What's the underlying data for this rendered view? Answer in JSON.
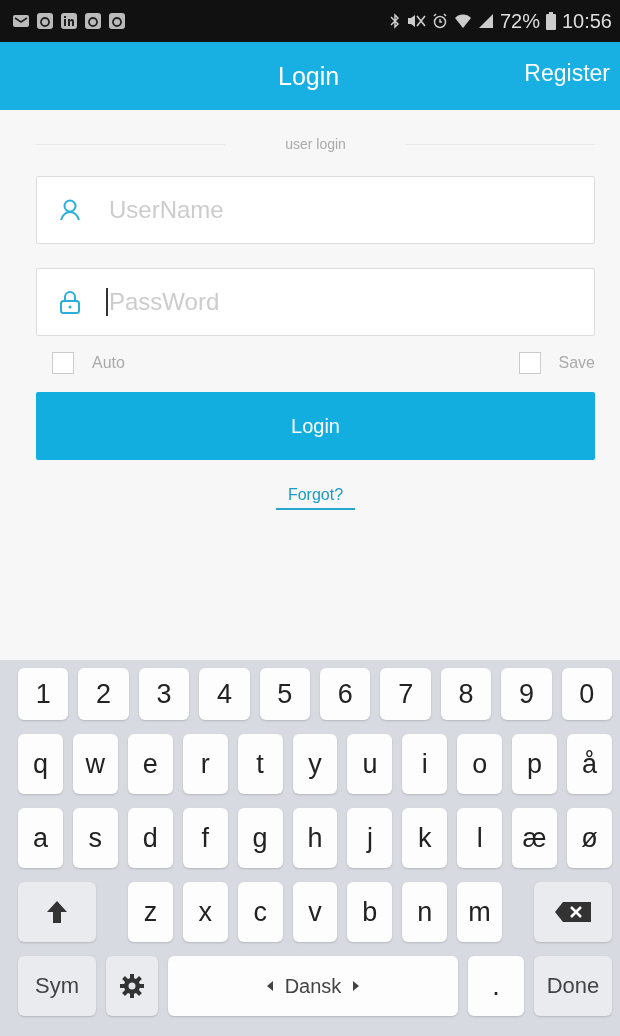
{
  "status_bar": {
    "battery": "72%",
    "time": "10:56"
  },
  "header": {
    "title": "Login",
    "action": "Register"
  },
  "form": {
    "section_label": "user login",
    "fields": [
      {
        "kind": "user",
        "placeholder": "UserName",
        "focused": false
      },
      {
        "kind": "password",
        "placeholder": "PassWord",
        "focused": true
      }
    ],
    "options": [
      {
        "label": "Auto",
        "checked": false
      },
      {
        "label": "Save",
        "checked": false
      }
    ],
    "submit": "Login",
    "forgot_link": "Forgot?"
  },
  "keyboard": {
    "rows": [
      {
        "keys": [
          {
            "kind": "char",
            "label": "1"
          },
          {
            "kind": "char",
            "label": "2"
          },
          {
            "kind": "char",
            "label": "3"
          },
          {
            "kind": "char",
            "label": "4"
          },
          {
            "kind": "char",
            "label": "5"
          },
          {
            "kind": "char",
            "label": "6"
          },
          {
            "kind": "char",
            "label": "7"
          },
          {
            "kind": "char",
            "label": "8"
          },
          {
            "kind": "char",
            "label": "9"
          },
          {
            "kind": "char",
            "label": "0"
          }
        ]
      },
      {
        "keys": [
          {
            "kind": "char",
            "label": "q"
          },
          {
            "kind": "char",
            "label": "w"
          },
          {
            "kind": "char",
            "label": "e"
          },
          {
            "kind": "char",
            "label": "r"
          },
          {
            "kind": "char",
            "label": "t"
          },
          {
            "kind": "char",
            "label": "y"
          },
          {
            "kind": "char",
            "label": "u"
          },
          {
            "kind": "char",
            "label": "i"
          },
          {
            "kind": "char",
            "label": "o"
          },
          {
            "kind": "char",
            "label": "p"
          },
          {
            "kind": "char",
            "label": "å"
          }
        ]
      },
      {
        "keys": [
          {
            "kind": "char",
            "label": "a"
          },
          {
            "kind": "char",
            "label": "s"
          },
          {
            "kind": "char",
            "label": "d"
          },
          {
            "kind": "char",
            "label": "f"
          },
          {
            "kind": "char",
            "label": "g"
          },
          {
            "kind": "char",
            "label": "h"
          },
          {
            "kind": "char",
            "label": "j"
          },
          {
            "kind": "char",
            "label": "k"
          },
          {
            "kind": "char",
            "label": "l"
          },
          {
            "kind": "char",
            "label": "æ"
          },
          {
            "kind": "char",
            "label": "ø"
          }
        ]
      },
      {
        "keys": [
          {
            "kind": "shift"
          },
          {
            "kind": "char",
            "label": "z"
          },
          {
            "kind": "char",
            "label": "x"
          },
          {
            "kind": "char",
            "label": "c"
          },
          {
            "kind": "char",
            "label": "v"
          },
          {
            "kind": "char",
            "label": "b"
          },
          {
            "kind": "char",
            "label": "n"
          },
          {
            "kind": "char",
            "label": "m"
          },
          {
            "kind": "backspace"
          }
        ]
      },
      {
        "keys": [
          {
            "kind": "function",
            "label": "Sym"
          },
          {
            "kind": "settings"
          },
          {
            "kind": "space",
            "label": "Dansk"
          },
          {
            "kind": "char",
            "label": "."
          },
          {
            "kind": "function",
            "label": "Done"
          }
        ]
      }
    ]
  }
}
